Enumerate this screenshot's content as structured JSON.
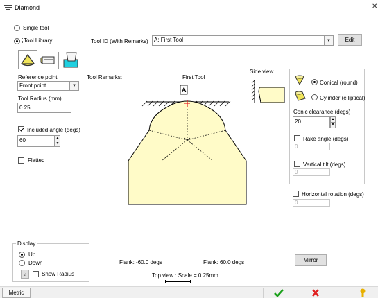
{
  "window": {
    "title": "Diamond"
  },
  "mode": {
    "single_tool_label": "Single tool",
    "tool_library_label": "Tool Library",
    "selected": "Tool Library"
  },
  "tool_id": {
    "label": "Tool ID (With Remarks)",
    "value": "A: First Tool",
    "edit_label": "Edit"
  },
  "tabs": [
    {
      "name": "tool-shape-tab",
      "icon": "diamond-cone-icon",
      "selected": true
    },
    {
      "name": "tool-holder-tab",
      "icon": "tool-holder-icon",
      "selected": false
    },
    {
      "name": "tool-setting-tab",
      "icon": "cyan-block-icon",
      "selected": false
    }
  ],
  "left": {
    "reference_point_label": "Reference point",
    "reference_point_value": "Front point",
    "tool_radius_label": "Tool Radius (mm)",
    "tool_radius_value": "0.25",
    "included_angle_label": "Included angle (degs)",
    "included_angle_value": "60",
    "included_angle_checked": true,
    "flatted_label": "Flatted",
    "flatted_checked": false
  },
  "center": {
    "tool_remarks_label": "Tool Remarks:",
    "tool_name": "First Tool",
    "point_marker": "A",
    "flank_left": "Flank: -60.0 degs",
    "flank_right": "Flank: 60.0 degs",
    "scale_text": "Top view : Scale = 0.25mm",
    "tool_fill": "#fffbc8",
    "marker_color": "#e51c23"
  },
  "side_view": {
    "label": "Side view"
  },
  "right": {
    "conical_label": "Conical  (round)",
    "cylinder_label": "Cylinder (elliptical)",
    "selected_shape": "Conical",
    "conic_clearance_label": "Conic clearance (degs)",
    "conic_clearance_value": "20",
    "rake_angle_label": "Rake angle (degs)",
    "rake_angle_value": "0",
    "rake_angle_checked": false,
    "vertical_tilt_label": "Vertical tilt (degs)",
    "vertical_tilt_value": "0",
    "vertical_tilt_checked": false,
    "horizontal_rotation_label": "Horizontal rotation (degs)",
    "horizontal_rotation_value": "0",
    "horizontal_rotation_checked": false
  },
  "display": {
    "label": "Display",
    "up_label": "Up",
    "down_label": "Down",
    "selected": "Up",
    "help_label": "?",
    "show_radius_label": "Show Radius",
    "show_radius_checked": false
  },
  "mirror_label": "Mirror",
  "bottom": {
    "metric_label": "Metric",
    "ok_color": "#1aa01a",
    "cancel_color": "#e02020",
    "help_color": "#e8b000"
  }
}
